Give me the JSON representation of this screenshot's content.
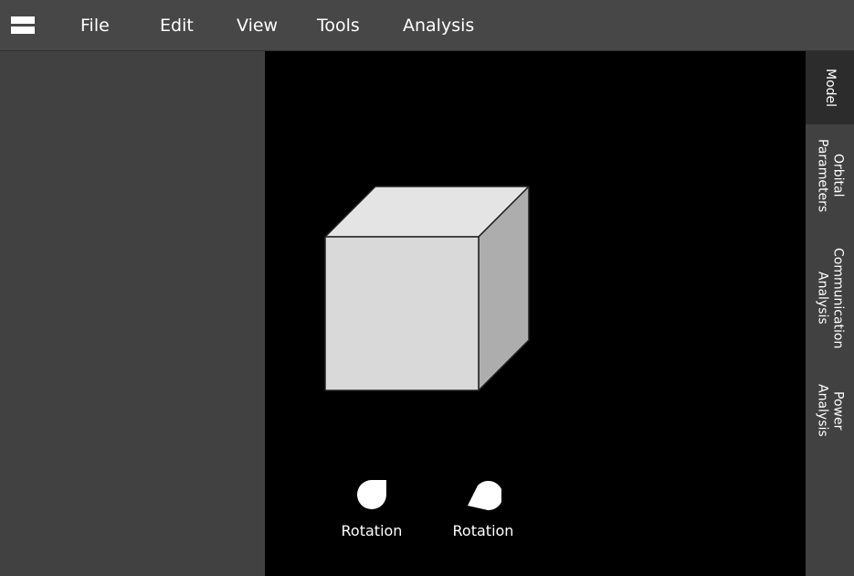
{
  "menubar": {
    "menu_icon": "hamburger-menu-icon",
    "items": [
      "File",
      "Edit",
      "View",
      "Tools",
      "Analysis"
    ]
  },
  "viewport": {
    "model": "cube",
    "colors": {
      "front": "#d9d9d9",
      "top": "#e4e4e4",
      "side": "#adadad",
      "edge": "#222222",
      "background": "#000000"
    },
    "controls": [
      {
        "label": "Rotation",
        "icon": "rotation-knob-icon"
      },
      {
        "label": "Rotation",
        "icon": "rotation-knob-icon"
      }
    ]
  },
  "side_tabs": {
    "items": [
      {
        "label": "Model",
        "active": true
      },
      {
        "label": "Orbital\nParameters",
        "active": false
      },
      {
        "label": "Communication\nAnalysis",
        "active": false
      },
      {
        "label": "Power\nAnalysis",
        "active": false
      }
    ]
  }
}
